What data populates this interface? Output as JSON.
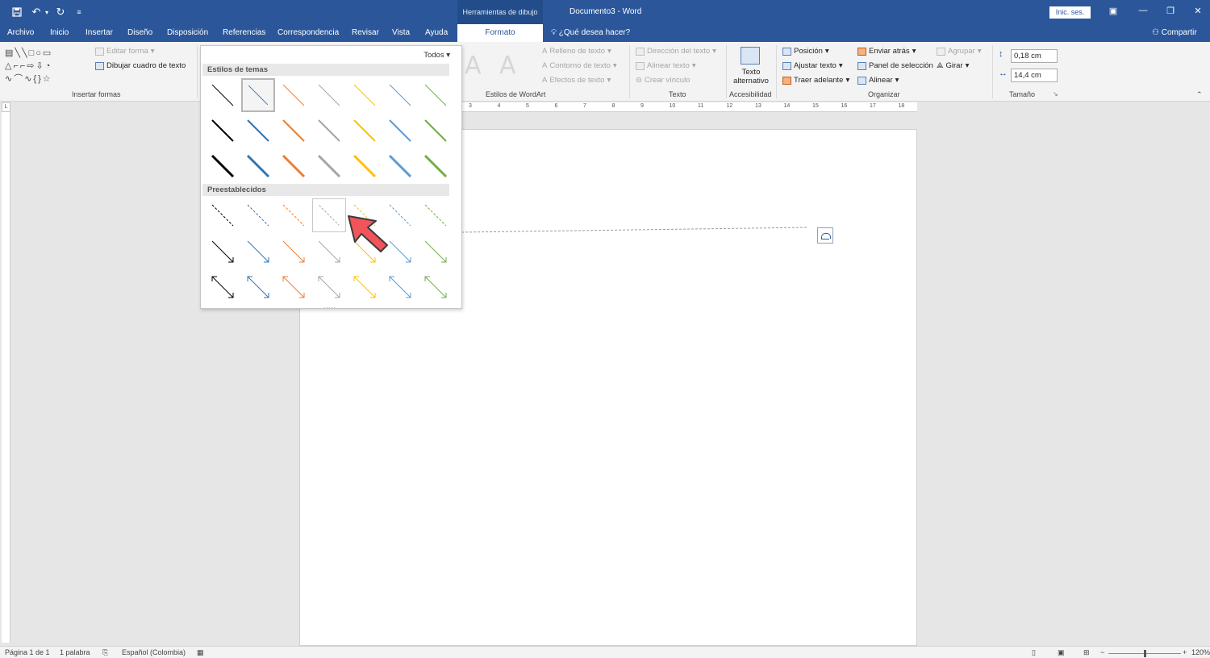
{
  "title_bar": {
    "context_label": "Herramientas de dibujo",
    "document_title": "Documento3  -  Word",
    "sign_in": "Inic. ses."
  },
  "tabs": [
    "Archivo",
    "Inicio",
    "Insertar",
    "Diseño",
    "Disposición",
    "Referencias",
    "Correspondencia",
    "Revisar",
    "Vista",
    "Ayuda",
    "Formato"
  ],
  "active_tab": "Formato",
  "tell_me": "¿Qué desea hacer?",
  "share": "Compartir",
  "ribbon": {
    "insert_shapes": {
      "edit_shape": "Editar forma",
      "draw_textbox": "Dibujar cuadro de texto",
      "label": "Insertar formas"
    },
    "wordart": {
      "text_fill": "Relleno de texto",
      "text_outline": "Contorno de texto",
      "text_effects": "Efectos de texto",
      "label": "Estilos de WordArt"
    },
    "text": {
      "direction": "Dirección del texto",
      "align": "Alinear texto",
      "link": "Crear vínculo",
      "label": "Texto"
    },
    "accessibility": {
      "alt_text_line1": "Texto",
      "alt_text_line2": "alternativo",
      "label": "Accesibilidad"
    },
    "arrange": {
      "position": "Posición",
      "wrap": "Ajustar texto",
      "forward": "Traer adelante",
      "backward": "Enviar atrás",
      "selection_pane": "Panel de selección",
      "align": "Alinear",
      "group": "Agrupar",
      "rotate": "Girar",
      "label": "Organizar"
    },
    "size": {
      "height": "0,18 cm",
      "width": "14,4 cm",
      "label": "Tamaño"
    }
  },
  "gallery": {
    "filter": "Todos",
    "theme_header": "Estilos de temas",
    "preset_header": "Preestablecidos",
    "colors": [
      "#000000",
      "#2e75b6",
      "#ed7d31",
      "#a5a5a5",
      "#ffc000",
      "#5b9bd5",
      "#70ad47"
    ],
    "theme_rows": [
      "thin",
      "medium",
      "thick"
    ],
    "preset_rows": [
      "dashed",
      "arrow",
      "double-arrow"
    ],
    "selected_theme_cell": [
      0,
      1
    ],
    "hovered_preset_cell": [
      0,
      3
    ]
  },
  "ruler_numbers": [
    "3",
    "4",
    "5",
    "6",
    "7",
    "8",
    "9",
    "10",
    "11",
    "12",
    "13",
    "14",
    "15",
    "16",
    "17",
    "18"
  ],
  "status_bar": {
    "page": "Página 1 de 1",
    "words": "1 palabra",
    "language": "Español (Colombia)",
    "zoom": "120%"
  }
}
